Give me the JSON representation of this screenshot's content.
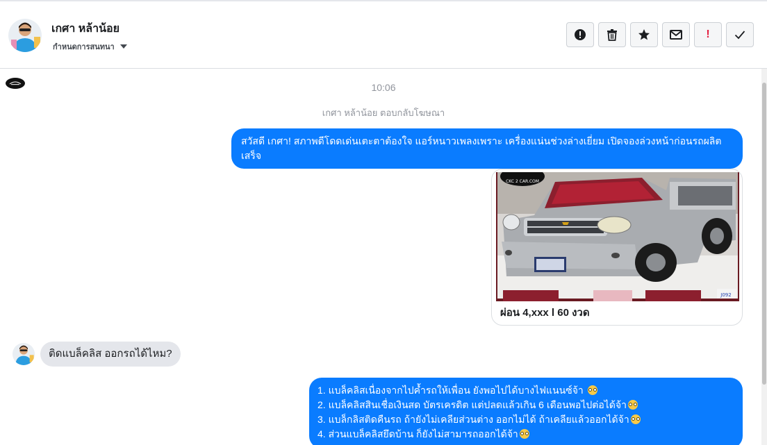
{
  "header": {
    "contact_name": "เกศา หล้าน้อย",
    "assign_label": "กำหนดการสนทนา",
    "actions": [
      {
        "name": "alert-icon"
      },
      {
        "name": "trash-icon"
      },
      {
        "name": "star-icon"
      },
      {
        "name": "envelope-icon"
      },
      {
        "name": "important-icon",
        "label": "!"
      },
      {
        "name": "check-icon"
      }
    ]
  },
  "chat": {
    "timestamp": "10:06",
    "system_note": "เกศา หล้าน้อย ตอบกลับโฆษณา",
    "messages": {
      "outgoing_1": "สวัสดี เกศา! สภาพดีโดดเด่นเตะตาต้องใจ แอร์หนาวเพลงเพราะ เครื่องแน่นช่วงล่างเยี่ยม เปิดจองล่วงหน้าก่อนรถผลิตเสร็จ",
      "card_caption": "ผ่อน 4,xxx l 60 งวด",
      "card_watermark": "CKC 2 CAR.COM",
      "card_tag": "J092",
      "incoming_1": "ติดแบล็คลิส ออกรถได้ไหม?",
      "outgoing_2_lines": [
        "1. แบล็คลิสเนื่องจากไปค้ำรถให้เพื่อน ยังพอไปได้บางไฟแนนซ์จ้า ",
        "2. แบล็คลิสสินเชื่อเงินสด บัตรเครดิต แต่ปลดแล้วเกิน 6 เดือนพอไปต่อได้จ้า",
        "3. แบล็กลิสติดคืนรถ ถ้ายังไม่เคลียส่วนต่าง ออกไม่ได้ ถ้าเคลียแล้วออกได้จ้า",
        "4. ส่วนแบล็คลิสยึดบ้าน ก็ยังไม่สามารถออกได้จ้า"
      ]
    }
  },
  "colors": {
    "outgoing_bubble": "#0a7cff",
    "incoming_bubble": "#e4e6eb",
    "important": "#e41e3f"
  }
}
